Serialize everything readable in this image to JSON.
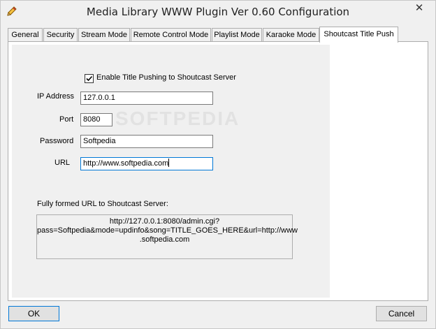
{
  "window": {
    "title": "Media Library WWW Plugin Ver 0.60 Configuration",
    "close_glyph": "✕",
    "app_icon": "pencil-icon"
  },
  "tabs": [
    {
      "label": "General",
      "active": false
    },
    {
      "label": "Security",
      "active": false
    },
    {
      "label": "Stream Mode",
      "active": false
    },
    {
      "label": "Remote Control Mode",
      "active": false
    },
    {
      "label": "Playlist Mode",
      "active": false
    },
    {
      "label": "Karaoke Mode",
      "active": false
    },
    {
      "label": "Shoutcast Title Push",
      "active": true
    }
  ],
  "form": {
    "enable_label": "Enable Title Pushing to Shoutcast Server",
    "enable_checked": true,
    "ip_label": "IP Address",
    "ip_value": "127.0.0.1",
    "port_label": "Port",
    "port_value": "8080",
    "password_label": "Password",
    "password_value": "Softpedia",
    "url_label": "URL",
    "url_value": "http://www.softpedia.com",
    "full_url_label": "Fully formed URL to Shoutcast Server:",
    "full_url_lines": [
      "http://127.0.0.1:8080/admin.cgi?",
      "pass=Softpedia&mode=updinfo&song=TITLE_GOES_HERE&url=http://www",
      ".softpedia.com"
    ]
  },
  "buttons": {
    "ok": "OK",
    "cancel": "Cancel"
  },
  "watermark": "SOFTPEDIA"
}
